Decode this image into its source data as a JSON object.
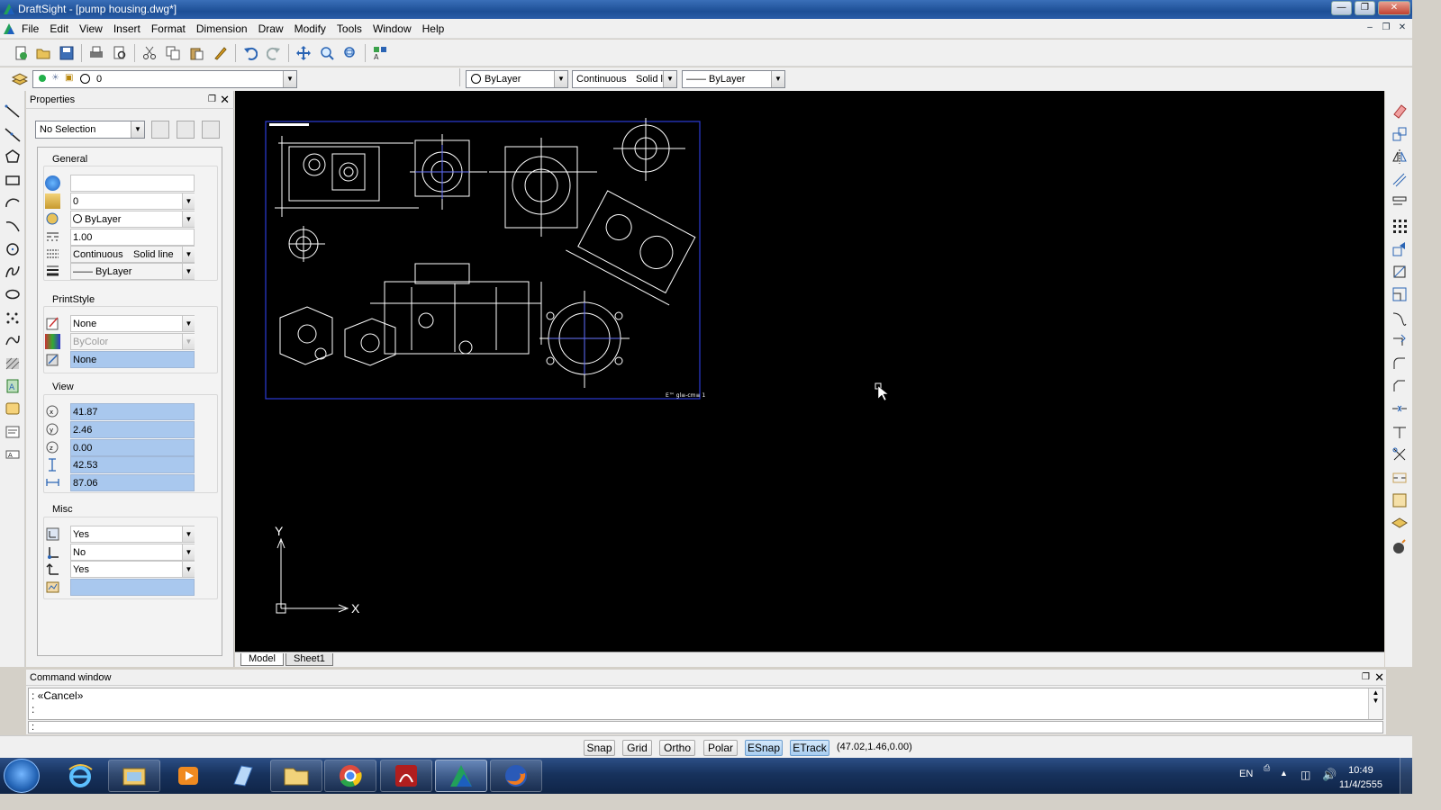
{
  "window": {
    "title": "DraftSight - [pump housing.dwg*]"
  },
  "menu": [
    "File",
    "Edit",
    "View",
    "Insert",
    "Format",
    "Dimension",
    "Draw",
    "Modify",
    "Tools",
    "Window",
    "Help"
  ],
  "layer_bar": {
    "layer": "0"
  },
  "style_bar": {
    "color": "ByLayer",
    "linetype": "Continuous",
    "linetype_desc": "Solid l",
    "lineweight": "—— ByLayer"
  },
  "properties": {
    "title": "Properties",
    "selection": "No Selection",
    "general": {
      "title": "General",
      "color": "",
      "layer": "0",
      "color_field": "ByLayer",
      "linetype_scale": "1.00",
      "linetype": "Continuous",
      "linetype_desc": "Solid line",
      "lineweight": "—— ByLayer"
    },
    "printstyle": {
      "title": "PrintStyle",
      "style": "None",
      "color_dependent": "ByColor",
      "table": "None"
    },
    "view": {
      "title": "View",
      "center_x": "41.87",
      "center_y": "2.46",
      "center_z": "0.00",
      "height": "42.53",
      "width": "87.06"
    },
    "misc": {
      "title": "Misc",
      "ucs_icon_on": "Yes",
      "ucs_icon_at_origin": "No",
      "ucs_per_viewport": "Yes",
      "ucs_name": ""
    }
  },
  "canvas": {
    "axis_x": "X",
    "axis_y": "Y"
  },
  "sheet_tabs": [
    "Model",
    "Sheet1"
  ],
  "command_window": {
    "title": "Command window",
    "line1": ": «Cancel»",
    "line2": ":",
    "prompt": ":"
  },
  "status_bar": {
    "buttons": [
      {
        "label": "Snap",
        "on": false
      },
      {
        "label": "Grid",
        "on": false
      },
      {
        "label": "Ortho",
        "on": false
      },
      {
        "label": "Polar",
        "on": false
      },
      {
        "label": "ESnap",
        "on": true
      },
      {
        "label": "ETrack",
        "on": true
      }
    ],
    "coords": "(47.02,1.46,0.00)"
  },
  "taskbar": {
    "apps": [
      "internet-explorer",
      "file-explorer",
      "media-player",
      "stationery",
      "folder",
      "chrome",
      "acrobat",
      "draftsight",
      "firefox"
    ],
    "language": "EN",
    "time": "10:49",
    "date": "11/4/2555"
  },
  "colors": {
    "title_bar": "#1d4f96",
    "canvas": "#000000",
    "highlight_field": "#a9c8ee",
    "taskbar": "#17325d"
  }
}
